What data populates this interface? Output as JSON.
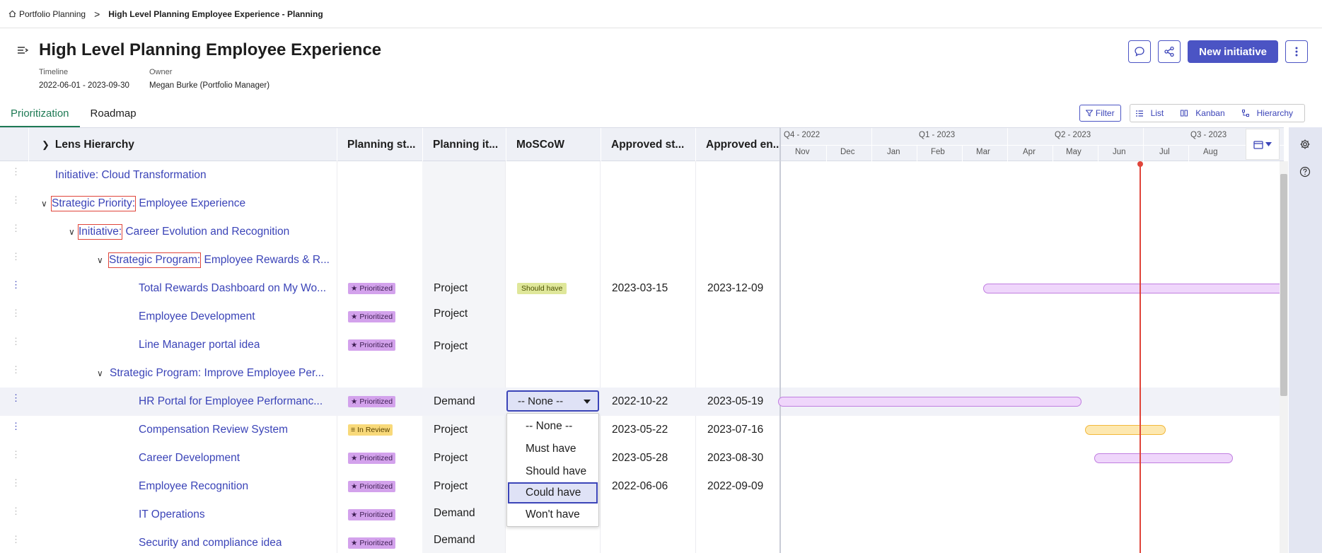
{
  "breadcrumb": {
    "root": "Portfolio Planning",
    "separator": ">",
    "current": "High Level Planning Employee Experience - Planning"
  },
  "header": {
    "title": "High Level Planning Employee Experience",
    "timeline_label": "Timeline",
    "timeline_value": "2022-06-01 - 2023-09-30",
    "owner_label": "Owner",
    "owner_value": "Megan Burke (Portfolio Manager)",
    "new_initiative": "New initiative"
  },
  "tabs": [
    "Prioritization",
    "Roadmap"
  ],
  "view_tools": {
    "filter": "Filter",
    "list": "List",
    "kanban": "Kanban",
    "hierarchy": "Hierarchy"
  },
  "columns": [
    "Lens Hierarchy",
    "Planning st...",
    "Planning it...",
    "MoSCoW",
    "Approved st...",
    "Approved en..."
  ],
  "rows": [
    {
      "prefix": "",
      "name": "Initiative: Cloud Transformation",
      "status": "",
      "item": "",
      "moscow": "",
      "start": "",
      "end": ""
    },
    {
      "prefix": "Strategic Priority:",
      "name": " Employee Experience",
      "status": "",
      "item": "",
      "moscow": "",
      "start": "",
      "end": ""
    },
    {
      "prefix": "Initiative:",
      "name": " Career Evolution and Recognition",
      "status": "",
      "item": "",
      "moscow": "",
      "start": "",
      "end": ""
    },
    {
      "prefix": "Strategic Program:",
      "name": " Employee Rewards & R...",
      "status": "",
      "item": "",
      "moscow": "",
      "start": "",
      "end": ""
    },
    {
      "prefix": "",
      "name": "Total Rewards Dashboard on My Wo...",
      "status": "Prioritized",
      "item": "Project",
      "moscow": "Should have",
      "start": "2023-03-15",
      "end": "2023-12-09"
    },
    {
      "prefix": "",
      "name": "Employee Development",
      "status": "Prioritized",
      "item": "Project",
      "moscow": "",
      "start": "",
      "end": ""
    },
    {
      "prefix": "",
      "name": "Line Manager portal idea",
      "status": "Prioritized",
      "item": "Project",
      "moscow": "",
      "start": "",
      "end": ""
    },
    {
      "prefix": "",
      "name": "Strategic Program: Improve Employee Per...",
      "status": "",
      "item": "",
      "moscow": "",
      "start": "",
      "end": ""
    },
    {
      "prefix": "",
      "name": "HR Portal for Employee Performanc...",
      "status": "Prioritized",
      "item": "Demand",
      "moscow": "",
      "start": "2022-10-22",
      "end": "2023-05-19"
    },
    {
      "prefix": "",
      "name": "Compensation Review System",
      "status": "In Review",
      "item": "Project",
      "moscow": "",
      "start": "2023-05-22",
      "end": "2023-07-16"
    },
    {
      "prefix": "",
      "name": "Career Development",
      "status": "Prioritized",
      "item": "Project",
      "moscow": "",
      "start": "2023-05-28",
      "end": "2023-08-30"
    },
    {
      "prefix": "",
      "name": "Employee Recognition",
      "status": "Prioritized",
      "item": "Project",
      "moscow": "",
      "start": "2022-06-06",
      "end": "2022-09-09"
    },
    {
      "prefix": "",
      "name": "IT Operations",
      "status": "Prioritized",
      "item": "Demand",
      "moscow": "",
      "start": "",
      "end": ""
    },
    {
      "prefix": "",
      "name": "Security and compliance idea",
      "status": "Prioritized",
      "item": "Demand",
      "moscow": "",
      "start": "",
      "end": ""
    }
  ],
  "timeline": {
    "quarters": [
      "Q4 - 2022",
      "Q1 - 2023",
      "Q2 - 2023",
      "Q3 - 2023"
    ],
    "months": [
      "Nov",
      "Dec",
      "Jan",
      "Feb",
      "Mar",
      "Apr",
      "May",
      "Jun",
      "Jul",
      "Aug"
    ]
  },
  "moscow_dropdown": {
    "value": "-- None --",
    "options": [
      "-- None --",
      "Must have",
      "Should have",
      "Could have",
      "Won't have"
    ],
    "highlighted": "Could have"
  },
  "colors": {
    "accent": "#4b54c4",
    "link": "#3b44b8",
    "today_line": "#e0453a",
    "prioritized": "#d3a2ec",
    "in_review": "#f8d97a"
  }
}
